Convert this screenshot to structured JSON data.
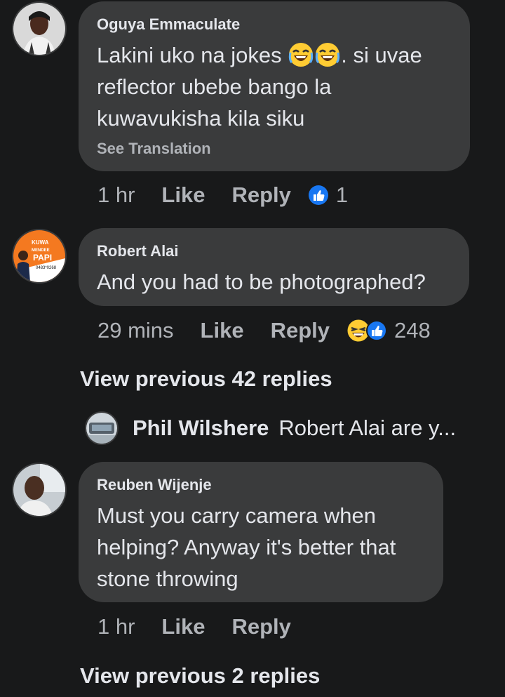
{
  "comments": [
    {
      "author": "Oguya Emmaculate",
      "text_a": "Lakini uko na jokes ",
      "text_b": ". si uvae",
      "text_line2": "reflector ubebe bango la",
      "text_line3": "kuwavukisha kila siku",
      "see_translation": "See Translation",
      "time": "1 hr",
      "like": "Like",
      "reply": "Reply",
      "reaction_count": "1",
      "reaction_icons": [
        "like-icon"
      ]
    },
    {
      "author": "Robert Alai",
      "text": "And you had to be photographed?",
      "time": "29 mins",
      "like": "Like",
      "reply": "Reply",
      "reaction_count": "248",
      "reaction_icons": [
        "laugh-emoji-icon",
        "like-icon"
      ],
      "avatar_text": [
        "KUWA",
        "MENDEE",
        "PAPI",
        "0483*0268"
      ]
    },
    {
      "author": "Reuben Wijenje",
      "text_line1": "Must you carry camera when",
      "text_line2": "helping? Anyway it's better that",
      "text_line3": "stone throwing",
      "time": "1 hr",
      "like": "Like",
      "reply": "Reply"
    }
  ],
  "view_previous_1": "View previous 42 replies",
  "reply_preview": {
    "name": "Phil Wilshere",
    "text": "Robert Alai are y..."
  },
  "view_previous_2": "View previous 2 replies",
  "colors": {
    "background": "#18191a",
    "bubble": "#3a3b3c",
    "text": "#e4e6eb",
    "secondary": "#b0b3b8",
    "like_blue": "#1877f2"
  }
}
